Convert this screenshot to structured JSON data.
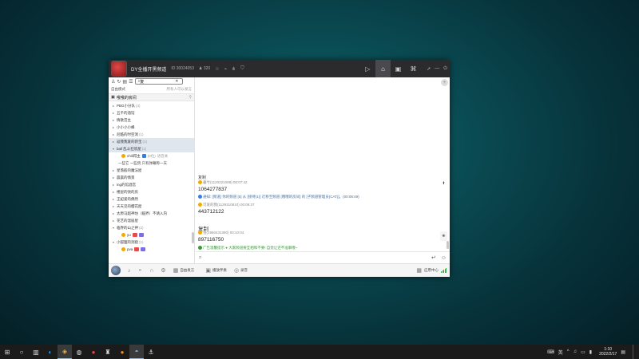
{
  "window": {
    "title": "DY全播开黑频道",
    "id_text": "ID 30024053",
    "online_count": "320",
    "nav_icons": [
      "video-icon",
      "home-icon",
      "tv-icon",
      "gamepad-icon",
      "phone-icon"
    ],
    "controls": [
      "arrow-icon",
      "minimize-icon",
      "power-icon"
    ]
  },
  "sidebar": {
    "search": {
      "value": "复",
      "placeholder": "搜索"
    },
    "mode_label": "自由模式",
    "mode_right": "所有人可以发言",
    "group_label": "哦哦的房间",
    "channels": [
      {
        "label": "PBG小分队",
        "count": "(4)"
      },
      {
        "label": "五千的酒馆",
        "count": ""
      },
      {
        "label": "情歌宫主",
        "count": ""
      },
      {
        "label": "小小小小蜂",
        "count": ""
      },
      {
        "label": "尼酷的时空洞",
        "count": "(1)"
      },
      {
        "label": "返我我爱的新宝",
        "count": "(1)"
      },
      {
        "label": "ball 乱斗狂欢屋",
        "count": "(1)"
      }
    ],
    "user_row": {
      "name": "chili得主",
      "extra": "(0位)",
      "tag": "语音关"
    },
    "sub_row": "一些它 一些鸽 只有弹幕称一天",
    "channels2": [
      {
        "label": "星落般的魔法屋",
        "count": ""
      },
      {
        "label": "晨晨的情景",
        "count": ""
      },
      {
        "label": "ing的馆酒宫",
        "count": ""
      },
      {
        "label": "楼层的快的房",
        "count": ""
      },
      {
        "label": "王妃爱的偶然",
        "count": ""
      },
      {
        "label": "天天见的樱花屋",
        "count": ""
      },
      {
        "label": "太原马超神坊（临界）不请入内",
        "count": ""
      },
      {
        "label": "花艺的温居屋",
        "count": ""
      },
      {
        "label": "临界的山之神",
        "count": "(2)"
      }
    ],
    "user_row2": {
      "name": "yu"
    },
    "channel_last": {
      "label": "小狐狸的洞窟",
      "count": "(1)"
    },
    "user_row3": {
      "name": "pva"
    }
  },
  "chat": {
    "copy1": "复制",
    "msg1_head": "暮兮(1120221098) 00:07:42",
    "msg1_body": "1064277837",
    "sys_msg": "通知: [频道] 你的频道 [5] 从 [接待(1)] 迁移至频道 [哦哦的房间] 的 [子频道管理员(CAT)]。(00:08:49)",
    "msg2_head": "可爱的我(1129310810) 00:09:37",
    "msg2_body": "443712122",
    "copy2": "复制",
    "msg3_head": "雪(1960431380) 00:10:04",
    "msg3_body": "897116750",
    "notice_green": "广告温馨提示 ● 大家频道要互相和不要! 自觉让还不准聊哦~",
    "input_placeholder": ""
  },
  "bottombar": {
    "free_speak": "自由发言",
    "play_music": "播放伴奏",
    "record": "录音",
    "app_center": "应用中心"
  },
  "taskbar": {
    "apps": [
      "windows-icon",
      "search-circle-icon",
      "taskview-icon",
      "edge-icon",
      "game-icon",
      "steam-icon",
      "browser-icon",
      "app-icon",
      "orange-icon",
      "steam2-icon",
      "anchor-icon"
    ],
    "tray": "英",
    "time": "1:10",
    "date": "2022/2/17"
  }
}
